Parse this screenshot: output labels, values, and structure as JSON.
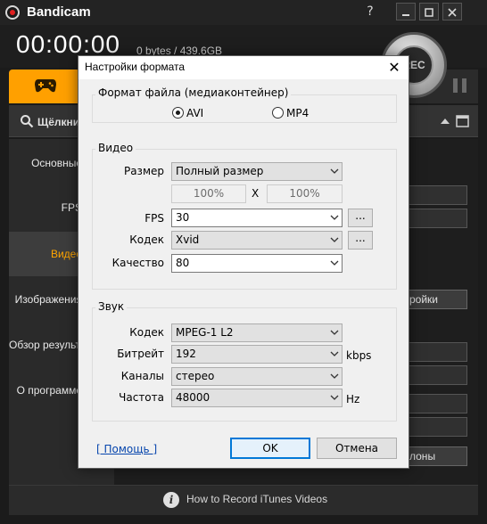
{
  "app": {
    "title": "Bandicam",
    "help_label": "?",
    "timer": "00:00:00",
    "file_size": "0 bytes / 439.6GB",
    "rec_label": "REC",
    "search_label": "Щёлкни",
    "accent_color": "#ffa000"
  },
  "sidebar": {
    "items": [
      {
        "label": "Основные"
      },
      {
        "label": "FPS"
      },
      {
        "label": "Видео"
      },
      {
        "label": "Изображения"
      },
      {
        "label": "Обзор результатов"
      },
      {
        "label": "О программе"
      }
    ]
  },
  "bg_buttons": {
    "settings_partial": "ройки",
    "templates_partial": "лоны"
  },
  "footer": {
    "info_icon": "i",
    "text": "How to Record iTunes Videos"
  },
  "dialog": {
    "title": "Настройки формата",
    "close_glyph": "✕",
    "container": {
      "label": "Формат файла (медиаконтейнер)",
      "options": [
        "AVI",
        "MP4"
      ],
      "selected": "AVI"
    },
    "video": {
      "label": "Видео",
      "size_label": "Размер",
      "size_value": "Полный размер",
      "width_pct": "100%",
      "x_label": "X",
      "height_pct": "100%",
      "fps_label": "FPS",
      "fps_value": "30",
      "codec_label": "Кодек",
      "codec_value": "Xvid",
      "quality_label": "Качество",
      "quality_value": "80",
      "more_label": "..."
    },
    "audio": {
      "label": "Звук",
      "codec_label": "Кодек",
      "codec_value": "MPEG-1 L2",
      "bitrate_label": "Битрейт",
      "bitrate_value": "192",
      "bitrate_unit": "kbps",
      "channels_label": "Каналы",
      "channels_value": "стерео",
      "freq_label": "Частота",
      "freq_value": "48000",
      "freq_unit": "Hz"
    },
    "help_link": "[ Помощь ]",
    "ok_label": "OK",
    "cancel_label": "Отмена"
  }
}
